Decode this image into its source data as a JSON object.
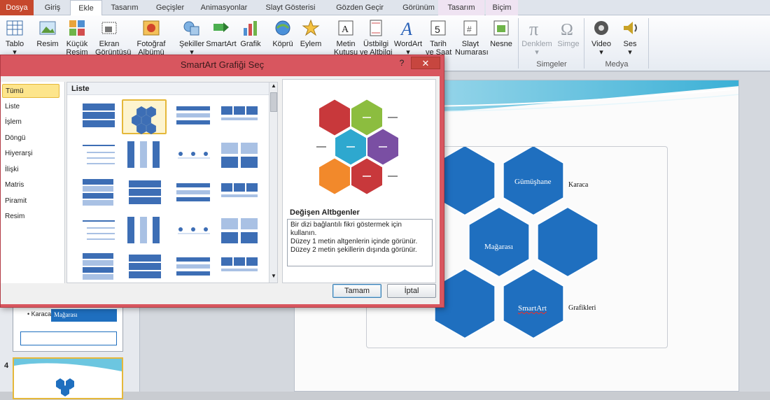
{
  "tabs": [
    {
      "label": "Dosya",
      "style": "file"
    },
    {
      "label": "Giriş",
      "style": ""
    },
    {
      "label": "Ekle",
      "style": "active"
    },
    {
      "label": "Tasarım",
      "style": ""
    },
    {
      "label": "Geçişler",
      "style": ""
    },
    {
      "label": "Animasyonlar",
      "style": ""
    },
    {
      "label": "Slayt Gösterisi",
      "style": ""
    },
    {
      "label": "Gözden Geçir",
      "style": ""
    },
    {
      "label": "Görünüm",
      "style": ""
    },
    {
      "label": "Tasarım",
      "style": "ctx"
    },
    {
      "label": "Biçim",
      "style": "ctx"
    }
  ],
  "ribbon": {
    "buttons": [
      {
        "label": "Tablo",
        "sub": "▾",
        "icon": "table-icon",
        "disabled": false
      },
      {
        "label": "Resim",
        "sub": "",
        "icon": "picture-icon",
        "disabled": false
      },
      {
        "label": "Küçük",
        "sub": "Resim",
        "icon": "clipart-icon",
        "disabled": false
      },
      {
        "label": "Ekran",
        "sub": "Görüntüsü",
        "icon": "screenshot-icon",
        "disabled": false
      },
      {
        "label": "Fotoğraf",
        "sub": "Albümü",
        "icon": "photo-album-icon",
        "disabled": false
      },
      {
        "label": "Şekiller",
        "sub": "▾",
        "icon": "shapes-icon",
        "disabled": false
      },
      {
        "label": "SmartArt",
        "sub": "",
        "icon": "smartart-icon",
        "disabled": false
      },
      {
        "label": "Grafik",
        "sub": "",
        "icon": "chart-icon",
        "disabled": false
      },
      {
        "label": "Köprü",
        "sub": "",
        "icon": "hyperlink-icon",
        "disabled": false
      },
      {
        "label": "Eylem",
        "sub": "",
        "icon": "action-icon",
        "disabled": false
      },
      {
        "label": "Metin",
        "sub": "Kutusu",
        "icon": "textbox-icon",
        "disabled": false
      },
      {
        "label": "Üstbilgi",
        "sub": "ve Altbilgi",
        "icon": "header-footer-icon",
        "disabled": false
      },
      {
        "label": "WordArt",
        "sub": "▾",
        "icon": "wordart-icon",
        "disabled": false
      },
      {
        "label": "Tarih",
        "sub": "ve Saat",
        "icon": "date-time-icon",
        "disabled": false
      },
      {
        "label": "Slayt",
        "sub": "Numarası",
        "icon": "slide-number-icon",
        "disabled": false
      },
      {
        "label": "Nesne",
        "sub": "",
        "icon": "object-icon",
        "disabled": false
      },
      {
        "label": "Denklem",
        "sub": "▾",
        "icon": "equation-icon",
        "disabled": true
      },
      {
        "label": "Simge",
        "sub": "",
        "icon": "symbol-icon",
        "disabled": true
      },
      {
        "label": "Video",
        "sub": "▾",
        "icon": "video-icon",
        "disabled": false
      },
      {
        "label": "Ses",
        "sub": "▾",
        "icon": "audio-icon",
        "disabled": false
      }
    ],
    "groups": {
      "symbols": "Simgeler",
      "media": "Medya"
    }
  },
  "dialog": {
    "title": "SmartArt Grafiği Seç",
    "help": "?",
    "close": "✕",
    "categories": [
      "Tümü",
      "Liste",
      "İşlem",
      "Döngü",
      "Hiyerarşi",
      "İlişki",
      "Matris",
      "Piramit",
      "Resim"
    ],
    "gallery_header": "Liste",
    "preview": {
      "title": "Değişen Altbgenler",
      "description": [
        "Bir dizi bağlantılı fikri göstermek için kullanın.",
        "Düzey 1 metin altgenlerin içinde görünür.",
        "Düzey 2 metin şekillerin dışında görünür."
      ],
      "hex_colors": [
        "#c8383b",
        "#8cbd3f",
        "#2ea8cf",
        "#7a4fa3",
        "#f2892b",
        "#c8383b"
      ]
    },
    "ok_label": "Tamam",
    "cancel_label": "İptal"
  },
  "slide": {
    "labels": {
      "hex1": "Gümüşhane",
      "side1": "Karaca",
      "hex2": "Mağarası",
      "hex3": "SmartArt",
      "side3": "Grafikleri"
    },
    "hex_color": "#1f6fbf"
  },
  "thumbs": {
    "bullet": "• Karaca",
    "box_label": "Mağarası",
    "slide_number": "4"
  }
}
